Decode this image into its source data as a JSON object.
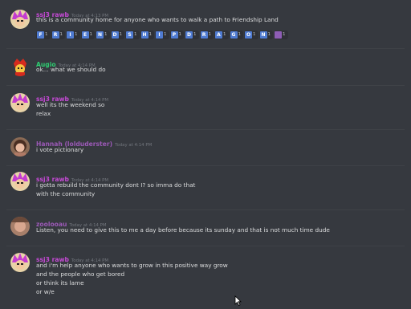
{
  "messages": [
    {
      "user": "ssj3 rawb",
      "color": "#c64ad6",
      "time": "Today at 4:13 PM",
      "lines": [
        "this is a community home for anyone who wants to walk a path to Friendship Land"
      ],
      "reactions": [
        "F",
        "R",
        "I",
        "E",
        "N",
        "D",
        "S",
        "H",
        "I",
        "P",
        "D",
        "R",
        "A",
        "G",
        "O",
        "N"
      ]
    },
    {
      "user": "Augio",
      "color": "#2ecc71",
      "time": "Today at 4:14 PM",
      "lines": [
        "ok... what we should do"
      ]
    },
    {
      "user": "ssj3 rawb",
      "color": "#c64ad6",
      "time": "Today at 4:14 PM",
      "lines": [
        "well its the weekend so",
        "relax"
      ]
    },
    {
      "user": "Hannah (lolduderster)",
      "color": "#9b59b6",
      "time": "Today at 4:14 PM",
      "lines": [
        "i vote pictionary"
      ]
    },
    {
      "user": "ssj3 rawb",
      "color": "#c64ad6",
      "time": "Today at 4:14 PM",
      "lines": [
        "i gotta rebuild the community dont I? so imma do that",
        "with the community"
      ]
    },
    {
      "user": "zoolooau",
      "color": "#9b59b6",
      "time": "Today at 4:14 PM",
      "lines": [
        "Listen, you need to give this to me a day before because its sunday and that is not much time dude"
      ]
    },
    {
      "user": "ssj3 rawb",
      "color": "#c64ad6",
      "time": "Today at 4:14 PM",
      "lines": [
        "and i'm help anyone who wants to grow in this positive way grow",
        "and the people who get bored",
        "or think its lame",
        "or w/e"
      ]
    }
  ]
}
